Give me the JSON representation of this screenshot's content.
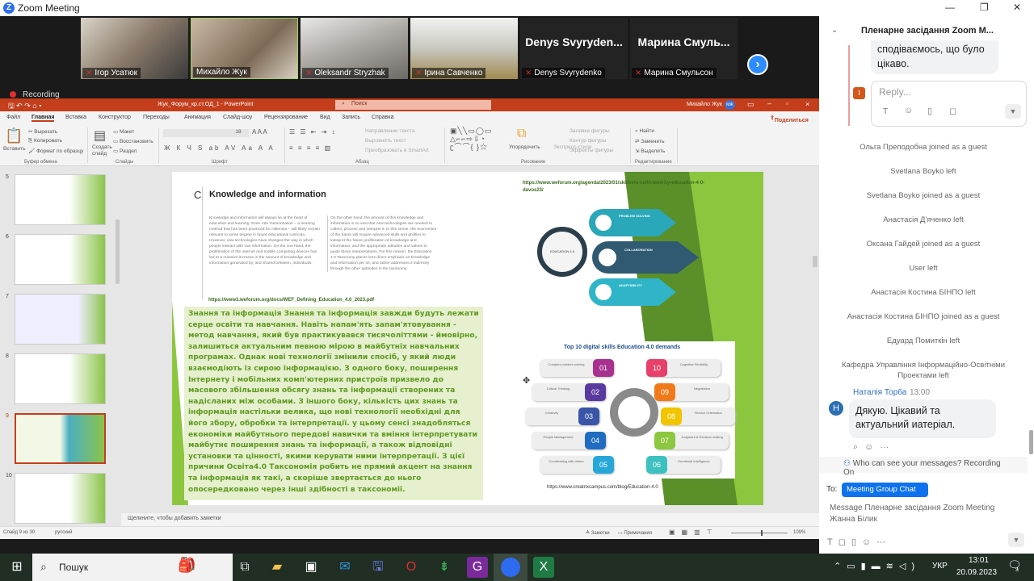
{
  "window": {
    "title": "Zoom Meeting",
    "min": "—",
    "max": "❐",
    "close": "✕"
  },
  "participants": [
    {
      "name": "Ігор Усатюк"
    },
    {
      "name": "Михайло Жук"
    },
    {
      "name": "Oleksandr Stryzhak"
    },
    {
      "name": "Ірина Савченко"
    },
    {
      "name": "Denys Svyrydenko",
      "display": "Denys Svyryden..."
    },
    {
      "name": "Марина Смульсон",
      "display": "Марина Смуль..."
    }
  ],
  "recording": "Recording",
  "ppt": {
    "title": "Жук_Форум_кр.ст.ОД_1 - PowerPoint",
    "search": "Поиск",
    "user": "Михайло Жук",
    "user_initials": "МЖ",
    "share": "Поделиться",
    "tabs": [
      "Файл",
      "Главная",
      "Вставка",
      "Конструктор",
      "Переходы",
      "Анимация",
      "Слайд-шоу",
      "Рецензирование",
      "Вид",
      "Запись",
      "Справка"
    ],
    "ribbon": {
      "paste": "Вставить",
      "cut": "Вырезать",
      "copy": "Копировать",
      "format_painter": "Формат по образцу",
      "clipboard": "Буфер обмена",
      "new_slide": "Создать слайд",
      "layout": "Макет",
      "reset": "Восстановить",
      "section": "Раздел",
      "slides": "Слайды",
      "font": "Шрифт",
      "font_size": "18",
      "text_direction": "Направление текста",
      "align_text": "Выровнять текст",
      "smartart": "Преобразовать в SmartArt",
      "paragraph": "Абзац",
      "arrange": "Упорядочить",
      "quick_styles": "Экспресс-стили",
      "shape_fill": "Заливка фигуры",
      "shape_outline": "Контур фигуры",
      "shape_effects": "Эффекты фигуры",
      "drawing": "Рисование",
      "find": "Найти",
      "replace": "Заменить",
      "select": "Выделить",
      "editing": "Редактирование"
    },
    "thumbnails": [
      {
        "num": "5"
      },
      {
        "num": "6"
      },
      {
        "num": "7"
      },
      {
        "num": "8"
      },
      {
        "num": "9",
        "selected": true
      },
      {
        "num": "10"
      }
    ],
    "notes_placeholder": "Щелкните, чтобы добавить заметки",
    "status": {
      "slide": "Слайд 9 из 30",
      "lang": "русский",
      "notes": "Заметки",
      "comments": "Примечания",
      "zoom": "109%"
    }
  },
  "slide": {
    "letter": "C",
    "heading": "Knowledge and information",
    "col1": "Knowledge and information will always lie at the heart of education and learning. Even rote memorization – a learning method that has been practiced for millennia – will likely remain relevant to some degree in future educational curricula. However, new technologies have changed the way in which people interact with raw information. On the one hand, the proliferation of the internet and mobile computing devices has led to a massive increase in the amount of knowledge and information generated by, and shared between, individuals.",
    "col2": "On the other hand, the amount of this knowledge and information is so vast that new technologies are needed to collect, process and interpret it. In this sense, the economies of the future will require advanced skills and abilities to interpret the future proliferation of knowledge and information, and the appropriate attitudes and values to guide those interpretations. For this reason, the Education 4.0 Taxonomy places less direct emphasis on knowledge and information per se, and rather addresses it indirectly through the other aptitudes in the taxonomy.",
    "url1": "https://www3.weforum.org/docs/WEF_Defining_Education_4.0_2023.pdf",
    "ua_text": "Знання та інформація Знання та інформація завжди будуть лежати серце освіти та навчання. Навіть напам'ять запам'ятовування - метод навчання, який був практикувався тисячоліттями - ймовірно, залишиться актуальним певною мірою в майбутніх навчальних програмах. Однак нові технології змінили спосіб, у який люди взаємодіють із сирою інформацією. З одного боку, поширення Інтернету і мобільних комп'ютерних пристроїв призвело до масового збільшення обсягу знань та інформації створених та надісланих між особами. З іншого боку, кількість цих знань та інформація настільки велика, що нові технології необхідні для його збору, обробки та інтерпретації. у цьому сенсі знадобляться економіки майбутнього передові навички та вміння інтерпретувати майбутнє поширення знань та інформації, а також відповідні установки та цінності, якими керувати ними інтерпретації. З цієї причини Освіта4.0 Таксономія робить не прямий акцент на знання та інформація як такі, а скоріше звертається до нього опосередковано через інші здібності в таксономії.",
    "url2": "https://www.weforum.org/agenda/2023/01/skillsets-cultivated-by-education-4-0-davos23/",
    "edu_center": "EDUCATION 4.0",
    "edu_items": [
      "PROBLEM SOLVING",
      "COLLABORATION",
      "ADAPTABILITY"
    ],
    "skills_title": "Top 10 digital skills Education 4.0 demands",
    "skills": [
      {
        "n": "01",
        "label": "Complex problem solving",
        "color": "#a8308f"
      },
      {
        "n": "02",
        "label": "Critical Thinking",
        "color": "#5b3aa0"
      },
      {
        "n": "03",
        "label": "Creativity",
        "color": "#3a55a8"
      },
      {
        "n": "04",
        "label": "People Management",
        "color": "#1f6cc0"
      },
      {
        "n": "05",
        "label": "Coordinating with others",
        "color": "#27a7d8"
      },
      {
        "n": "06",
        "label": "Emotional Intelligence",
        "color": "#3fc0c0"
      },
      {
        "n": "07",
        "label": "Judgment & Decision making",
        "color": "#8dc63f"
      },
      {
        "n": "08",
        "label": "Service Orientation",
        "color": "#f2c500"
      },
      {
        "n": "09",
        "label": "Negotiation",
        "color": "#f07a1a"
      },
      {
        "n": "10",
        "label": "Cognitive Flexibility",
        "color": "#e8406a"
      }
    ],
    "url3": "https://www.creatrixcampus.com/blog/Education-4.0"
  },
  "chat": {
    "title": "Пленарне засідання Zoom M...",
    "prev_bubble": "сподіваємось, що було цікаво.",
    "reply_avatar": "I",
    "reply_placeholder": "Reply...",
    "system": [
      "Ольга Преподобна joined as a guest",
      "Svetlana Boyko left",
      "Svetlana Boyko joined as a guest",
      "Анастасія Д'яченко left",
      "Оксана Гайдей joined as a guest",
      "User left",
      "Анастасія Костина БІНПО left",
      "Анастасія Костина БІНПО joined as a guest",
      "Едуард Помиткін left",
      "Кафедра Управління Інформаційно-Освітніми Проектами left"
    ],
    "msg": {
      "avatar": "H",
      "sender": "Наталія Торба",
      "time": "13:00",
      "text": "Дякую. Цікавий та актуальний иатеріал."
    },
    "who_can_see": "Who can see your messages? Recording On",
    "to_label": "To:",
    "to_value": "Meeting Group Chat",
    "input_placeholder": "Message Пленарне засідання Zoom Meeting Жанна Білик",
    "accent": "#0e72ed"
  },
  "taskbar": {
    "search": "Пошук",
    "lang": "УКР",
    "time": "13:01",
    "date": "20.09.2023",
    "notifications": "3"
  }
}
